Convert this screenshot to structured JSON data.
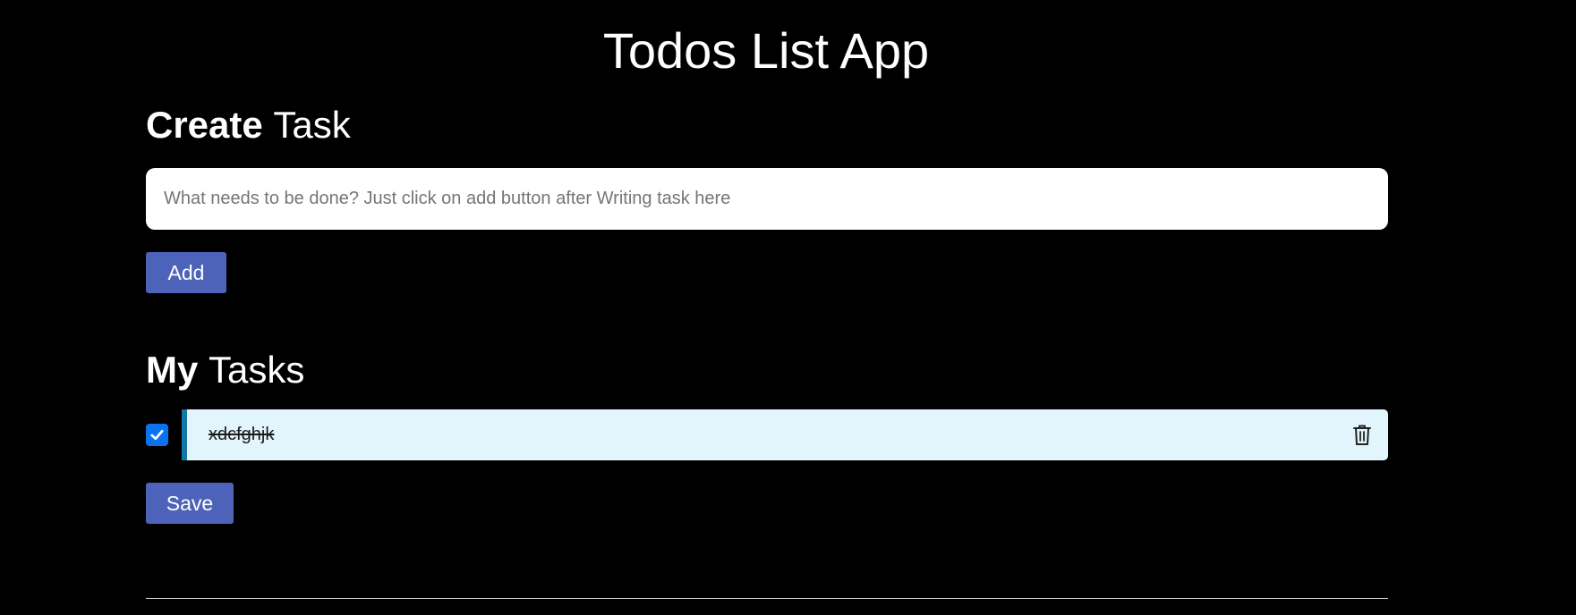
{
  "app": {
    "title": "Todos List App"
  },
  "create_section": {
    "heading_strong": "Create",
    "heading_light": "Task",
    "input": {
      "placeholder": "What needs to be done? Just click on add button after Writing task here",
      "value": ""
    },
    "add_label": "Add"
  },
  "tasks_section": {
    "heading_strong": "My",
    "heading_light": "Tasks",
    "tasks": [
      {
        "label": "xdcfghjk",
        "checked": true
      }
    ],
    "save_label": "Save"
  },
  "icons": {
    "checkbox": "check-icon",
    "delete": "trash-icon"
  },
  "colors": {
    "background": "#000000",
    "button": "#4d63ba",
    "task_background": "#e2f5fd",
    "task_accent": "#1676a7",
    "checkbox": "#0a74f0"
  }
}
